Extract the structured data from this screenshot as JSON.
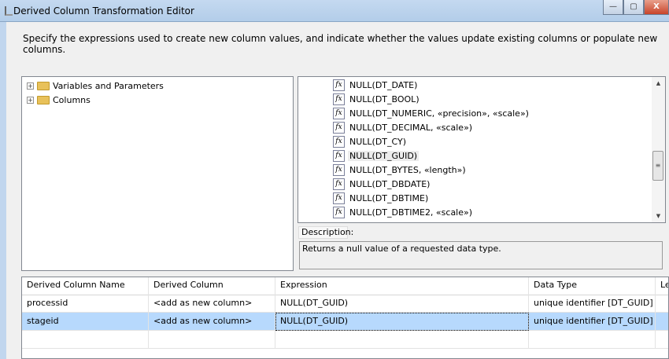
{
  "window": {
    "title": "Derived Column Transformation Editor",
    "minimize": "—",
    "maximize": "▢",
    "close": "X"
  },
  "instruction": "Specify the expressions used to create new column values, and indicate whether the values update existing columns or populate new columns.",
  "tree": [
    {
      "label": "Variables and Parameters"
    },
    {
      "label": "Columns"
    }
  ],
  "functions": [
    {
      "label": "NULL(DT_DATE)"
    },
    {
      "label": "NULL(DT_BOOL)"
    },
    {
      "label": "NULL(DT_NUMERIC, «precision», «scale»)"
    },
    {
      "label": "NULL(DT_DECIMAL, «scale»)"
    },
    {
      "label": "NULL(DT_CY)"
    },
    {
      "label": "NULL(DT_GUID)"
    },
    {
      "label": "NULL(DT_BYTES, «length»)"
    },
    {
      "label": "NULL(DT_DBDATE)"
    },
    {
      "label": "NULL(DT_DBTIME)"
    },
    {
      "label": "NULL(DT_DBTIME2, «scale»)"
    }
  ],
  "description": {
    "label": "Description:",
    "text": "Returns a null value of a requested data type."
  },
  "grid": {
    "headers": [
      "Derived Column Name",
      "Derived Column",
      "Expression",
      "Data Type",
      "Le"
    ],
    "rows": [
      [
        "processid",
        "<add as new column>",
        "NULL(DT_GUID)",
        "unique identifier [DT_GUID]",
        ""
      ],
      [
        "stageid",
        "<add as new column>",
        "NULL(DT_GUID)",
        "unique identifier [DT_GUID]",
        ""
      ]
    ]
  }
}
